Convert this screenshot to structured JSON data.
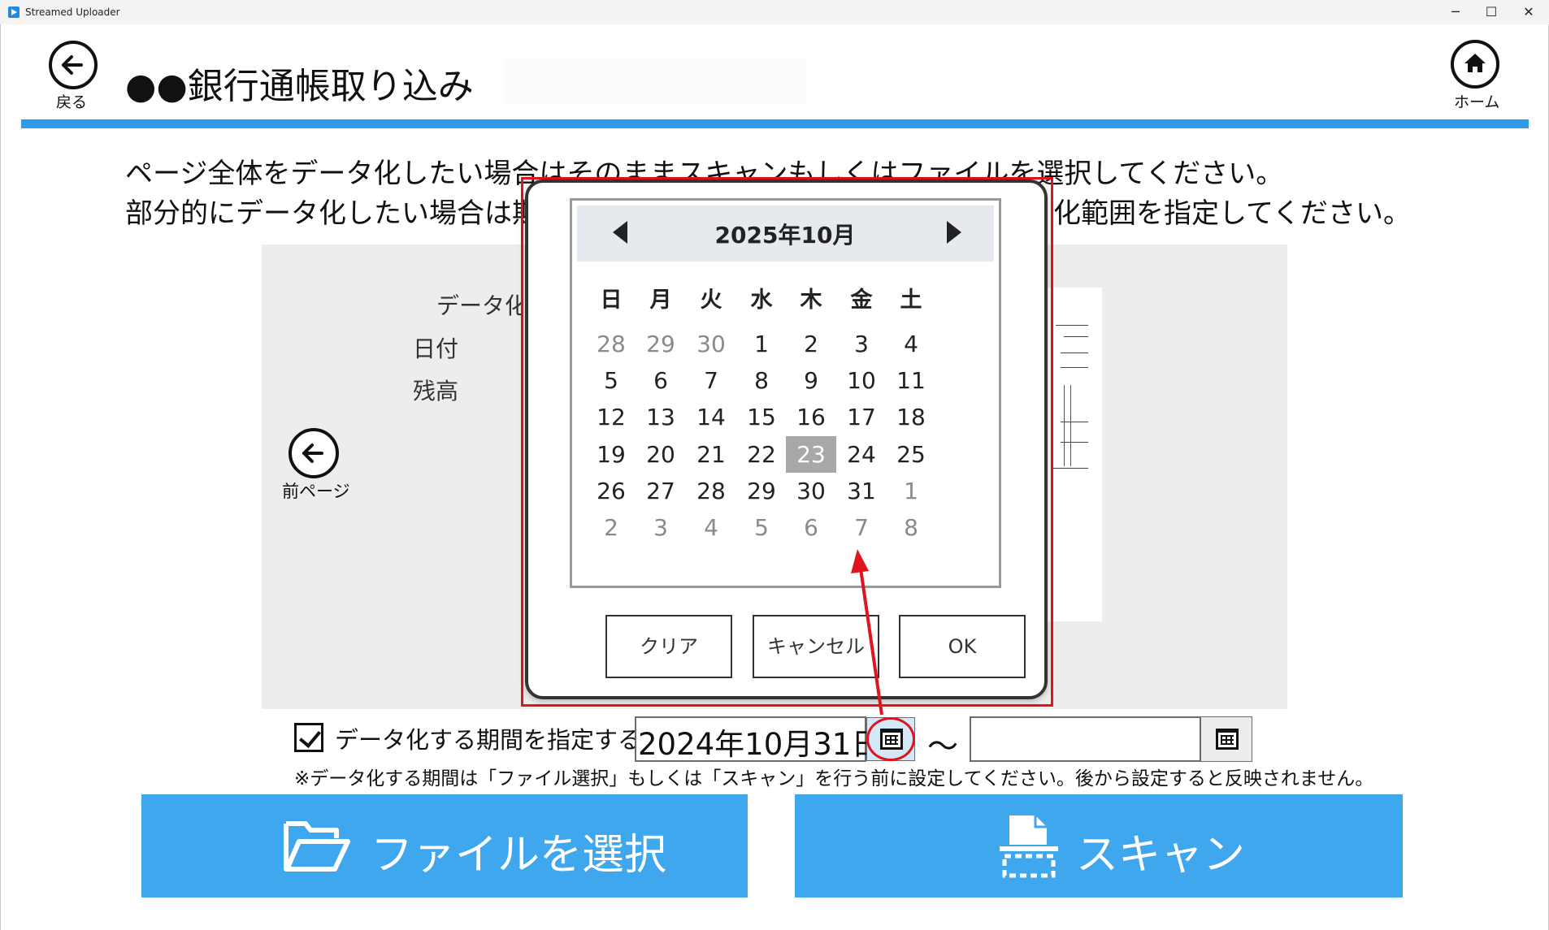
{
  "window": {
    "title": "Streamed Uploader",
    "minimize": "─",
    "maximize": "☐",
    "close": "✕"
  },
  "header": {
    "back_label": "戻る",
    "home_label": "ホーム",
    "title": "●●銀行通帳取り込み"
  },
  "instructions": {
    "line1": "ページ全体をデータ化したい場合はそのままスキャンもしくはファイルを選択してください。",
    "line2_left": "部分的にデータ化したい場合は期",
    "line2_right": "化範囲を指定してください。"
  },
  "preview": {
    "label_datafy": "データ化",
    "label_date": "日付",
    "label_balance": "残高",
    "prev_page_label": "前ページ"
  },
  "calendar": {
    "month_label": "2025年10月",
    "weekdays": [
      "日",
      "月",
      "火",
      "水",
      "木",
      "金",
      "土"
    ],
    "weeks": [
      [
        "28",
        "29",
        "30",
        "1",
        "2",
        "3",
        "4"
      ],
      [
        "5",
        "6",
        "7",
        "8",
        "9",
        "10",
        "11"
      ],
      [
        "12",
        "13",
        "14",
        "15",
        "16",
        "17",
        "18"
      ],
      [
        "19",
        "20",
        "21",
        "22",
        "23",
        "24",
        "25"
      ],
      [
        "26",
        "27",
        "28",
        "29",
        "30",
        "31",
        "1"
      ],
      [
        "2",
        "3",
        "4",
        "5",
        "6",
        "7",
        "8"
      ]
    ],
    "selected_day": "23",
    "clear_label": "クリア",
    "cancel_label": "キャンセル",
    "ok_label": "OK"
  },
  "period": {
    "checkbox_label": "データ化する期間を指定する",
    "checked": true,
    "start_date": "2024年10月31日",
    "end_date": "",
    "separator": "～",
    "note": "※データ化する期間は「ファイル選択」もしくは「スキャン」を行う前に設定してください。後から設定すると反映されません。"
  },
  "actions": {
    "file_select_label": "ファイルを選択",
    "scan_label": "スキャン"
  },
  "colors": {
    "accent_blue": "#2f9be8",
    "button_blue": "#3ea7ee",
    "highlight_red": "#e0141e",
    "selected_day_gray": "#a8a8a8"
  }
}
